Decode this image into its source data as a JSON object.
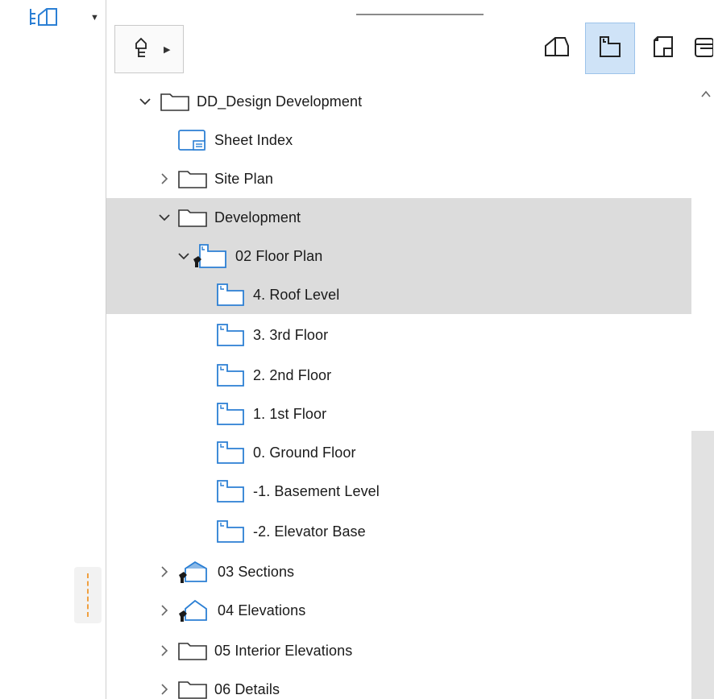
{
  "left_panel": {
    "top_icon": "house-structure-icon"
  },
  "toolbar": {
    "tree_dropdown_icon": "tree-structure-icon",
    "view_buttons": [
      {
        "icon": "project-map-icon"
      },
      {
        "icon": "view-map-icon",
        "active": true
      },
      {
        "icon": "layout-book-icon"
      },
      {
        "icon": "publisher-sets-icon"
      }
    ]
  },
  "tree": [
    {
      "label": "DD_Design Development",
      "icon": "folder-icon",
      "expanded": true,
      "indent": 1
    },
    {
      "label": "Sheet Index",
      "icon": "sheet-index-icon",
      "indent": 2
    },
    {
      "label": "Site Plan",
      "icon": "folder-icon",
      "expanded": false,
      "indent": 2
    },
    {
      "label": "Development",
      "icon": "folder-icon",
      "expanded": true,
      "indent": 2,
      "selected": true
    },
    {
      "label": "02 Floor Plan",
      "icon": "floor-plan-folder-icon",
      "expanded": true,
      "indent": 3,
      "selected": true
    },
    {
      "label": "4. Roof Level",
      "icon": "floor-plan-icon",
      "indent": 4,
      "selected": true
    },
    {
      "label": "3. 3rd Floor",
      "icon": "floor-plan-icon",
      "indent": 4
    },
    {
      "label": "2. 2nd Floor",
      "icon": "floor-plan-icon",
      "indent": 4
    },
    {
      "label": "1. 1st Floor",
      "icon": "floor-plan-icon",
      "indent": 4
    },
    {
      "label": "0. Ground Floor",
      "icon": "floor-plan-icon",
      "indent": 4
    },
    {
      "label": "-1. Basement Level",
      "icon": "floor-plan-icon",
      "indent": 4
    },
    {
      "label": "-2. Elevator Base",
      "icon": "floor-plan-icon",
      "indent": 4
    },
    {
      "label": "03 Sections",
      "icon": "section-folder-icon",
      "expanded": false,
      "indent": 2
    },
    {
      "label": "04 Elevations",
      "icon": "elevation-folder-icon",
      "expanded": false,
      "indent": 2
    },
    {
      "label": "05 Interior Elevations",
      "icon": "folder-icon",
      "expanded": false,
      "indent": 2
    },
    {
      "label": "06 Details",
      "icon": "folder-icon",
      "expanded": false,
      "indent": 2
    }
  ],
  "colors": {
    "accent_blue": "#2b7fd4",
    "selection": "#dcdcdc",
    "active_button": "#cfe3f7",
    "grip_dashes": "#f0a040"
  }
}
